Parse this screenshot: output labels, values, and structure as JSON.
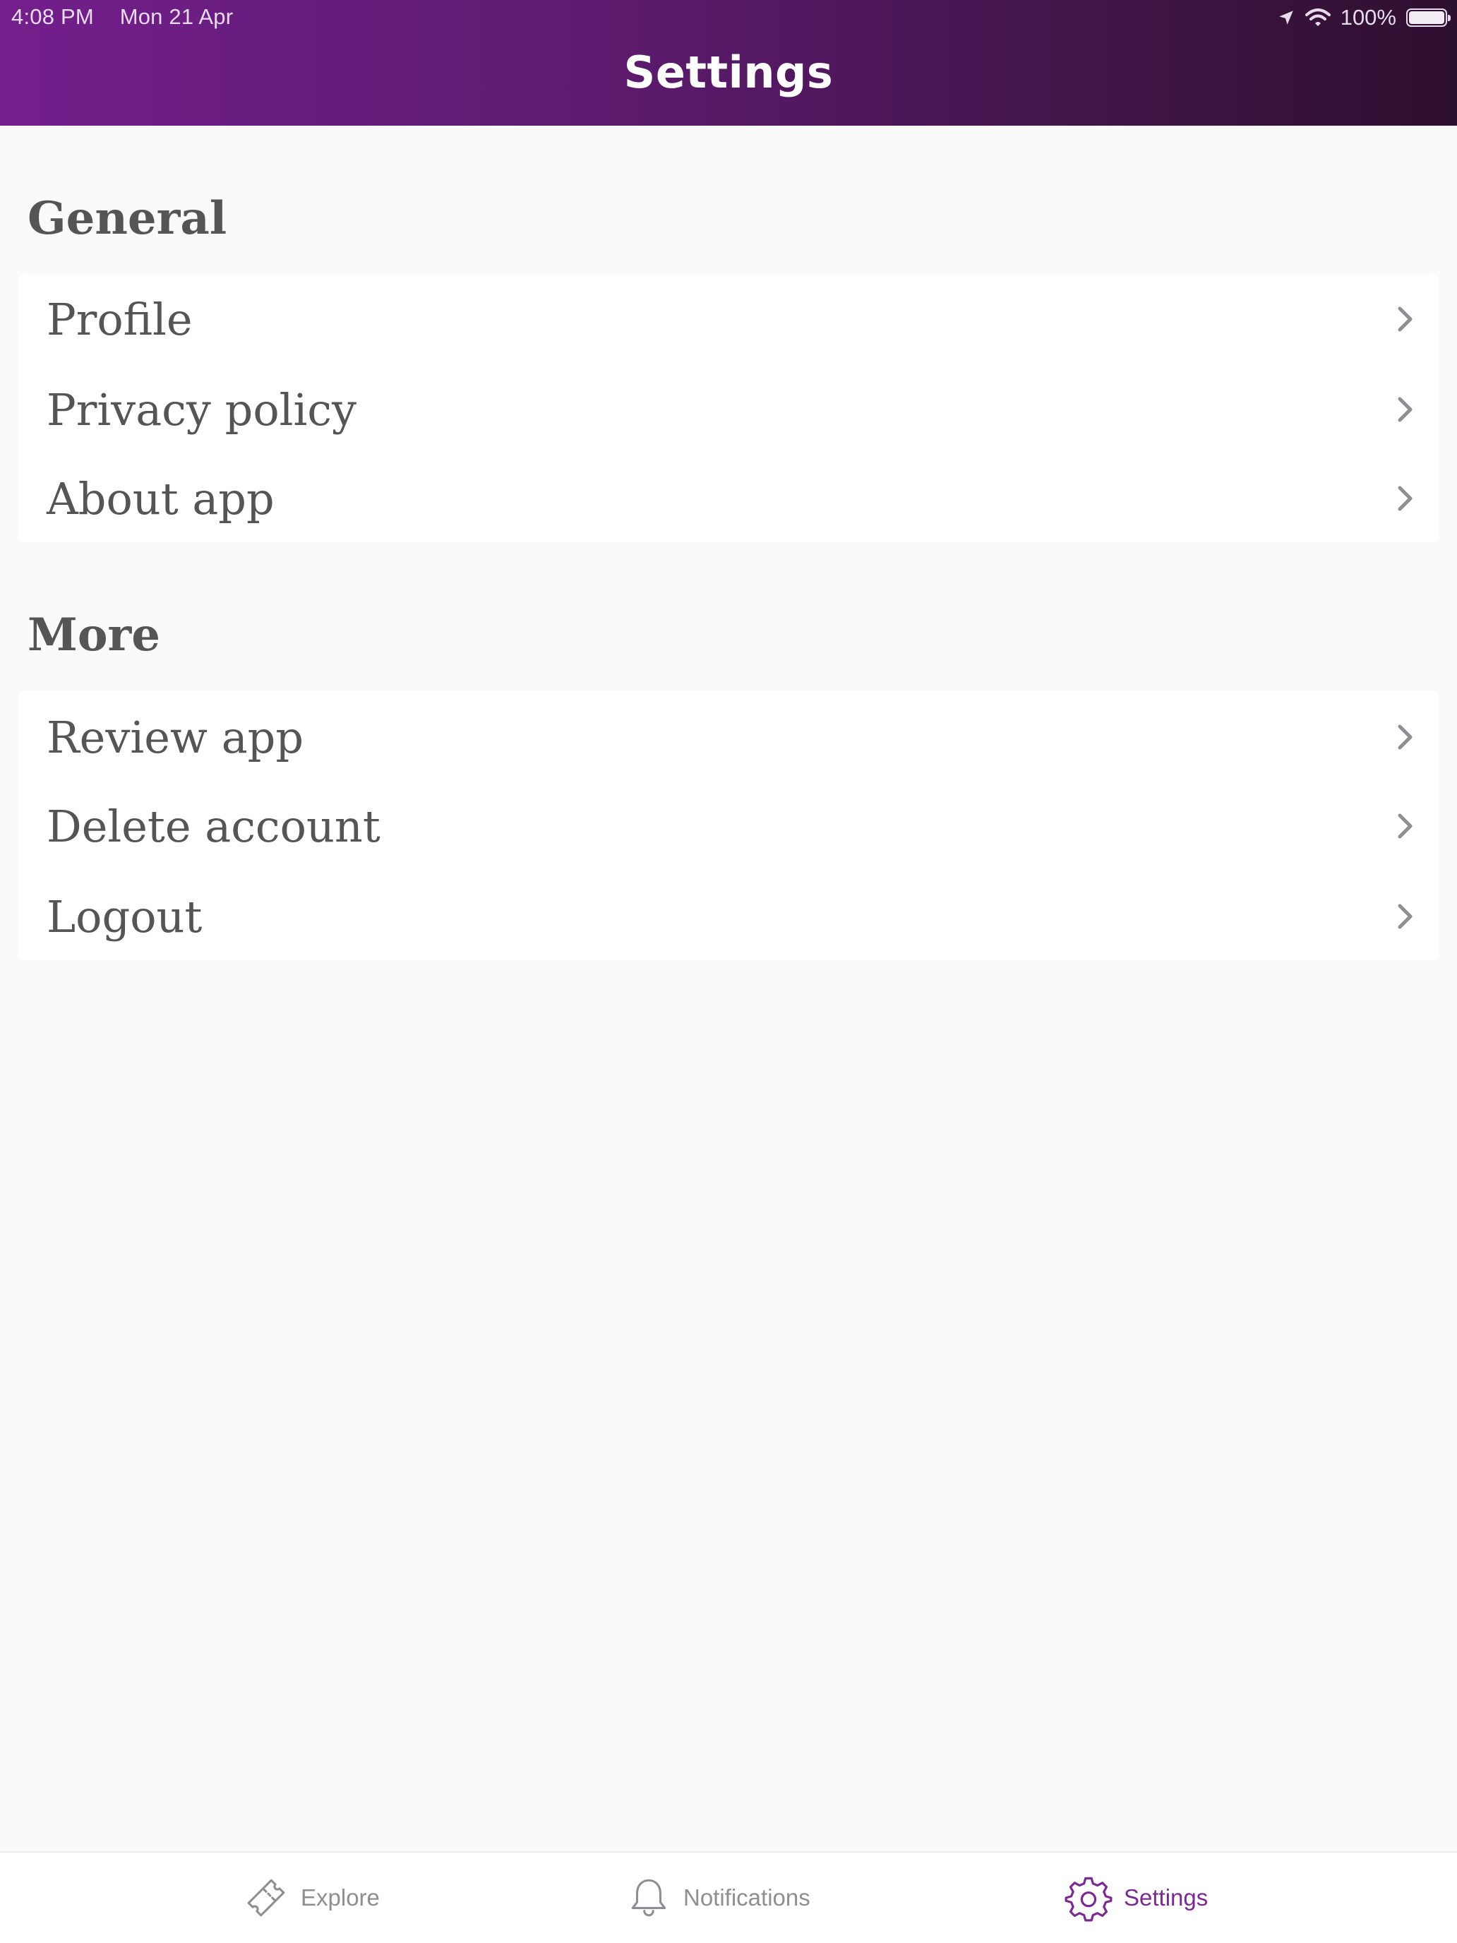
{
  "status_bar": {
    "time": "4:08 PM",
    "date": "Mon 21 Apr",
    "battery_percent": "100%",
    "icons": [
      "location-icon",
      "wifi-icon",
      "battery-icon"
    ]
  },
  "header": {
    "title": "Settings",
    "gradient_colors": [
      "#731f8c",
      "#2e1030"
    ]
  },
  "sections": {
    "general": {
      "title": "General",
      "items": [
        {
          "label": "Profile",
          "icon": "chevron-right-icon"
        },
        {
          "label": "Privacy policy",
          "icon": "chevron-right-icon"
        },
        {
          "label": "About app",
          "icon": "chevron-right-icon"
        }
      ]
    },
    "more": {
      "title": "More",
      "items": [
        {
          "label": "Review app",
          "icon": "chevron-right-icon"
        },
        {
          "label": "Delete account",
          "icon": "chevron-right-icon"
        },
        {
          "label": "Logout",
          "icon": "chevron-right-icon"
        }
      ]
    }
  },
  "tabbar": {
    "tabs": [
      {
        "label": "Explore",
        "icon": "ticket-icon",
        "active": false
      },
      {
        "label": "Notifications",
        "icon": "bell-icon",
        "active": false
      },
      {
        "label": "Settings",
        "icon": "gear-icon",
        "active": true
      }
    ],
    "active_color": "#7b2a8f",
    "inactive_color": "#8e8e93"
  }
}
